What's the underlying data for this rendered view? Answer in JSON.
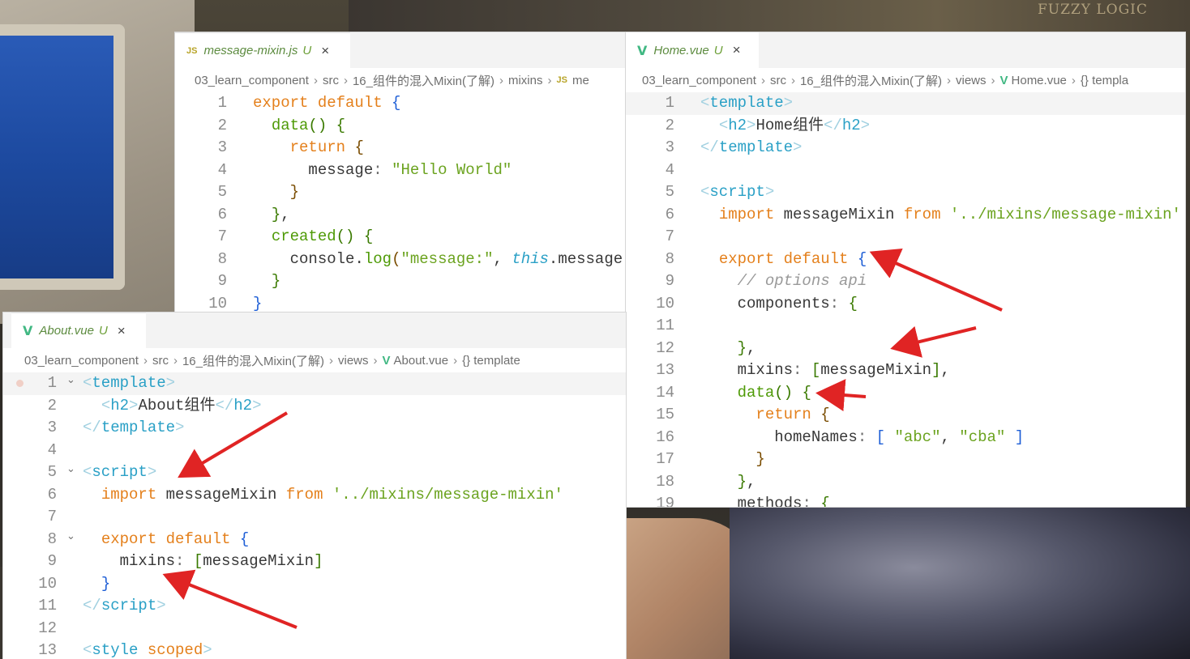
{
  "background": {
    "box_text": "FUZZY LOGIC"
  },
  "panels": [
    {
      "id": "mixin",
      "tab": {
        "icon": "JS",
        "name": "message-mixin.js",
        "badge": "U",
        "close": "×"
      },
      "breadcrumb": [
        "03_learn_component",
        "src",
        "16_组件的混入Mixin(了解)",
        "mixins",
        "me"
      ],
      "lines": [
        {
          "n": "1",
          "html": "<span class='k'>export default</span> <span class='b1'>{</span>"
        },
        {
          "n": "2",
          "html": "  <span class='f'>data</span><span class='b2'>()</span> <span class='b2'>{</span>"
        },
        {
          "n": "3",
          "html": "    <span class='k'>return</span> <span class='b3'>{</span>"
        },
        {
          "n": "4",
          "html": "      <span class='p'>message</span><span class='pk'>:</span> <span class='s'>\"Hello World\"</span>"
        },
        {
          "n": "5",
          "html": "    <span class='b3'>}</span>"
        },
        {
          "n": "6",
          "html": "  <span class='b2'>}</span>,"
        },
        {
          "n": "7",
          "html": "  <span class='f'>created</span><span class='b2'>()</span> <span class='b2'>{</span>"
        },
        {
          "n": "8",
          "html": "    <span class='p'>console</span>.<span class='f'>log</span><span class='b3'>(</span><span class='s'>\"message:\"</span>, <span class='th'>this</span>.<span class='p'>message</span><span class='b3'>)</span>"
        },
        {
          "n": "9",
          "html": "  <span class='b2'>}</span>"
        },
        {
          "n": "10",
          "html": "<span class='b1'>}</span>"
        }
      ]
    },
    {
      "id": "home",
      "tab": {
        "icon": "V",
        "name": "Home.vue",
        "badge": "U",
        "close": "×"
      },
      "breadcrumb": [
        "03_learn_component",
        "src",
        "16_组件的混入Mixin(了解)",
        "views",
        "Home.vue",
        "{} templa"
      ],
      "lines": [
        {
          "n": "1",
          "html": "<span class='tb'>&lt;</span><span class='t'>template</span><span class='tb'>&gt;</span>"
        },
        {
          "n": "2",
          "html": "  <span class='tb'>&lt;</span><span class='t'>h2</span><span class='tb'>&gt;</span><span class='p'>Home组件</span><span class='tb'>&lt;/</span><span class='t'>h2</span><span class='tb'>&gt;</span>"
        },
        {
          "n": "3",
          "html": "<span class='tb'>&lt;/</span><span class='t'>template</span><span class='tb'>&gt;</span>"
        },
        {
          "n": "4",
          "html": ""
        },
        {
          "n": "5",
          "html": "<span class='tb'>&lt;</span><span class='t'>script</span><span class='tb'>&gt;</span>"
        },
        {
          "n": "6",
          "html": "  <span class='k'>import</span> <span class='p'>messageMixin</span> <span class='k'>from</span> <span class='s'>'../mixins/message-mixin'</span>"
        },
        {
          "n": "7",
          "html": ""
        },
        {
          "n": "8",
          "html": "  <span class='k'>export default</span> <span class='b1'>{</span>"
        },
        {
          "n": "9",
          "html": "    <span class='c'>// options api</span>"
        },
        {
          "n": "10",
          "html": "    <span class='p'>components</span><span class='pk'>:</span> <span class='b2'>{</span>"
        },
        {
          "n": "11",
          "html": ""
        },
        {
          "n": "12",
          "html": "    <span class='b2'>}</span>,"
        },
        {
          "n": "13",
          "html": "    <span class='p'>mixins</span><span class='pk'>:</span> <span class='b2'>[</span><span class='p'>messageMixin</span><span class='b2'>]</span>,"
        },
        {
          "n": "14",
          "html": "    <span class='f'>data</span><span class='b2'>()</span> <span class='b2'>{</span>"
        },
        {
          "n": "15",
          "html": "      <span class='k'>return</span> <span class='b3'>{</span>"
        },
        {
          "n": "16",
          "html": "        <span class='p'>homeNames</span><span class='pk'>:</span> <span class='b1'>[</span> <span class='s'>\"abc\"</span>, <span class='s'>\"cba\"</span> <span class='b1'>]</span>"
        },
        {
          "n": "17",
          "html": "      <span class='b3'>}</span>"
        },
        {
          "n": "18",
          "html": "    <span class='b2'>}</span>,"
        },
        {
          "n": "19",
          "html": "    <span class='p'>methods</span><span class='pk'>:</span> <span class='b2'>{</span>"
        }
      ]
    },
    {
      "id": "about",
      "tab": {
        "icon": "V",
        "name": "About.vue",
        "badge": "U",
        "close": "×"
      },
      "breadcrumb": [
        "03_learn_component",
        "src",
        "16_组件的混入Mixin(了解)",
        "views",
        "About.vue",
        "{} template"
      ],
      "lines": [
        {
          "n": "1",
          "html": "<span class='tb'>&lt;</span><span class='t'>template</span><span class='tb'>&gt;</span>"
        },
        {
          "n": "2",
          "html": "  <span class='tb'>&lt;</span><span class='t'>h2</span><span class='tb'>&gt;</span><span class='p'>About组件</span><span class='tb'>&lt;/</span><span class='t'>h2</span><span class='tb'>&gt;</span>"
        },
        {
          "n": "3",
          "html": "<span class='tb'>&lt;/</span><span class='t'>template</span><span class='tb'>&gt;</span>"
        },
        {
          "n": "4",
          "html": ""
        },
        {
          "n": "5",
          "html": "<span class='tb'>&lt;</span><span class='t'>script</span><span class='tb'>&gt;</span>"
        },
        {
          "n": "6",
          "html": "  <span class='k'>import</span> <span class='p'>messageMixin</span> <span class='k'>from</span> <span class='s'>'../mixins/message-mixin'</span>"
        },
        {
          "n": "7",
          "html": ""
        },
        {
          "n": "8",
          "html": "  <span class='k'>export default</span> <span class='b1'>{</span>"
        },
        {
          "n": "9",
          "html": "    <span class='p'>mixins</span><span class='pk'>:</span> <span class='b2'>[</span><span class='p'>messageMixin</span><span class='b2'>]</span>"
        },
        {
          "n": "10",
          "html": "  <span class='b1'>}</span>"
        },
        {
          "n": "11",
          "html": "<span class='tb'>&lt;/</span><span class='t'>script</span><span class='tb'>&gt;</span>"
        },
        {
          "n": "12",
          "html": ""
        },
        {
          "n": "13",
          "html": "<span class='tb'>&lt;</span><span class='t'>style</span> <span class='k'>scoped</span><span class='tb'>&gt;</span>"
        }
      ]
    }
  ],
  "colors": {
    "vue": "#41b883",
    "js": "#b8a428",
    "arrow": "#e02424"
  }
}
